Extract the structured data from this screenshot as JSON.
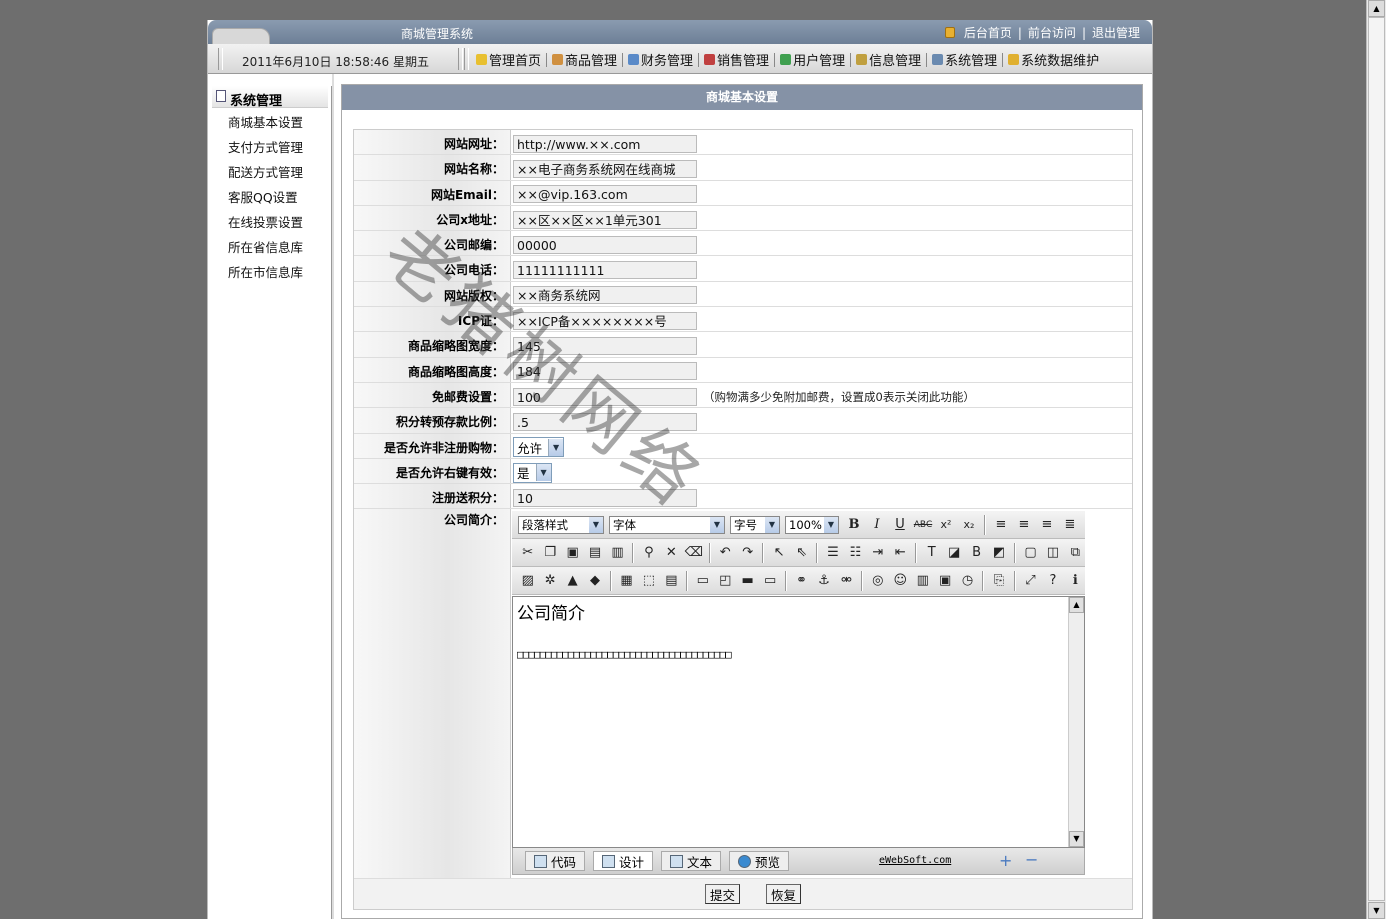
{
  "topbar": {
    "title": "商城管理系统",
    "links": [
      "后台首页",
      "前台访问",
      "退出管理"
    ],
    "sep": "|"
  },
  "menubar": {
    "datetime": "2011年6月10日  18:58:46 星期五",
    "items": [
      "管理首页",
      "商品管理",
      "财务管理",
      "销售管理",
      "用户管理",
      "信息管理",
      "系统管理",
      "系统数据维护"
    ]
  },
  "sidebar": {
    "heading": "系统管理",
    "items": [
      "商城基本设置",
      "支付方式管理",
      "配送方式管理",
      "客服QQ设置",
      "在线投票设置",
      "所在省信息库",
      "所在市信息库"
    ]
  },
  "panel": {
    "title": "商城基本设置"
  },
  "form": {
    "site_url": {
      "label": "网站网址：",
      "value": "http://www.××.com"
    },
    "site_name": {
      "label": "网站名称：",
      "value": "××电子商务系统网在线商城"
    },
    "site_email": {
      "label": "网站Email：",
      "value": "××@vip.163.com"
    },
    "company_address": {
      "label": "公司x地址：",
      "value": "××区××区××1单元301"
    },
    "company_zip": {
      "label": "公司邮编：",
      "value": "00000"
    },
    "company_phone": {
      "label": "公司电话：",
      "value": "11111111111"
    },
    "copyright": {
      "label": "网站版权：",
      "value": "××商务系统网"
    },
    "icp": {
      "label": "ICP证：",
      "value": "××ICP备××××××××号"
    },
    "thumb_width": {
      "label": "商品缩略图宽度：",
      "value": "145"
    },
    "thumb_height": {
      "label": "商品缩略图高度：",
      "value": "184"
    },
    "free_shipping": {
      "label": "免邮费设置：",
      "value": "100",
      "hint": "（购物满多少免附加邮费，设置成0表示关闭此功能）"
    },
    "points_ratio": {
      "label": "积分转预存款比例：",
      "value": ".5"
    },
    "allow_guest": {
      "label": "是否允许非注册购物：",
      "value": "允许"
    },
    "allow_rightclick": {
      "label": "是否允许右键有效：",
      "value": "是"
    },
    "register_points": {
      "label": "注册送积分：",
      "value": "10"
    },
    "intro": {
      "label": "公司简介："
    }
  },
  "editor": {
    "selects": {
      "paragraph": "段落样式",
      "font": "字体",
      "size": "字号",
      "zoom": "100%"
    },
    "content_heading": "公司简介",
    "content_body": "□□□□□□□□□□□□□□□□□□□□□□□□□□□□□□□□□□□□□□",
    "modes": [
      "代码",
      "设计",
      "文本",
      "预览"
    ],
    "brand": "eWebSoft.com",
    "zoom_in": "+",
    "zoom_out": "−"
  },
  "actions": {
    "submit": "提交",
    "reset": "恢复"
  },
  "watermark": "老猪树网络",
  "colors": {
    "title_bar": "#8592a6",
    "topbar": "#7a8ba2"
  }
}
